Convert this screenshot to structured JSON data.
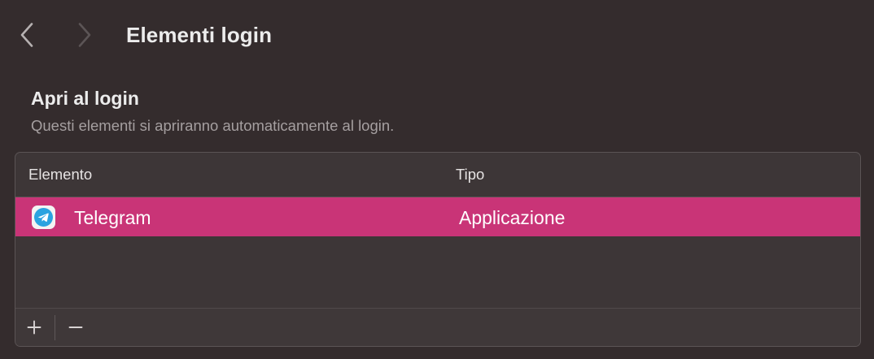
{
  "window": {
    "title": "Elementi login"
  },
  "toolbar": {
    "back_icon": "chevron-left-icon",
    "forward_icon": "chevron-right-icon"
  },
  "section": {
    "title": "Apri al login",
    "subtitle": "Questi elementi si apriranno automaticamente al login."
  },
  "table": {
    "columns": [
      "Elemento",
      "Tipo"
    ],
    "rows": [
      {
        "icon": "telegram-icon",
        "name": "Telegram",
        "type": "Applicazione",
        "selected": true
      }
    ],
    "footer": {
      "add_label": "+",
      "remove_label": "−"
    }
  },
  "colors": {
    "background": "#342c2d",
    "table_background": "#3d3637",
    "selection": "#c93477",
    "telegram_blue": "#2aa3e0",
    "secondary_text": "#a59fa0"
  }
}
